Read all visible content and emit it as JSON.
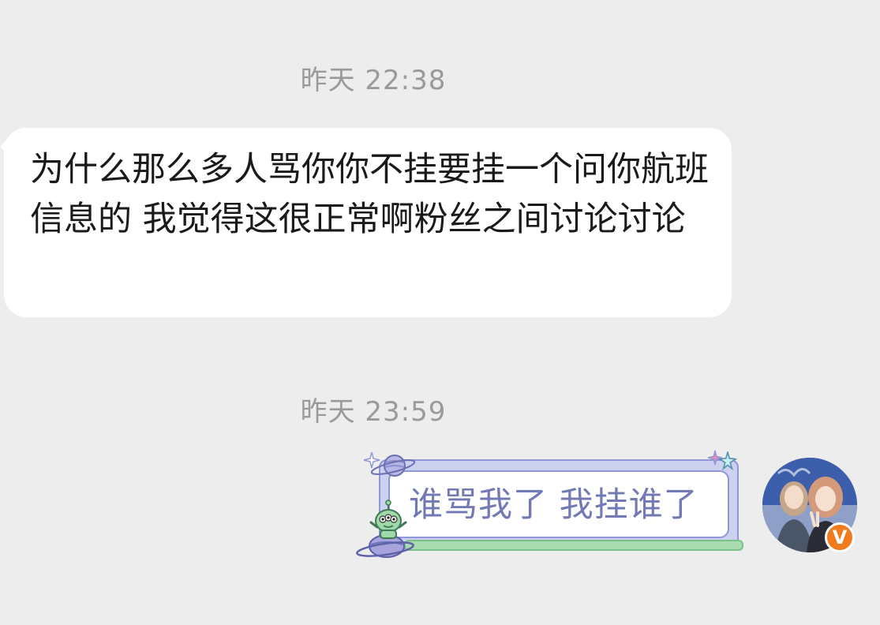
{
  "messages": {
    "first_timestamp": "昨天 22:38",
    "incoming": {
      "text": "为什么那么多人骂你你不挂要挂一个问你航班信息的 我觉得这很正常啊粉丝之间讨论讨论"
    },
    "second_timestamp": "昨天 23:59",
    "outgoing": {
      "text": "谁骂我了 我挂谁了"
    }
  },
  "avatar": {
    "badge": "V"
  },
  "colors": {
    "background": "#ededed",
    "incoming_bubble": "#ffffff",
    "outgoing_text": "#7379b4",
    "outgoing_frame": "#cdd1f0",
    "badge": "#f07a1c"
  },
  "icons": [
    "planet-icon",
    "sparkle-icon",
    "alien-icon",
    "verified-badge-icon"
  ]
}
